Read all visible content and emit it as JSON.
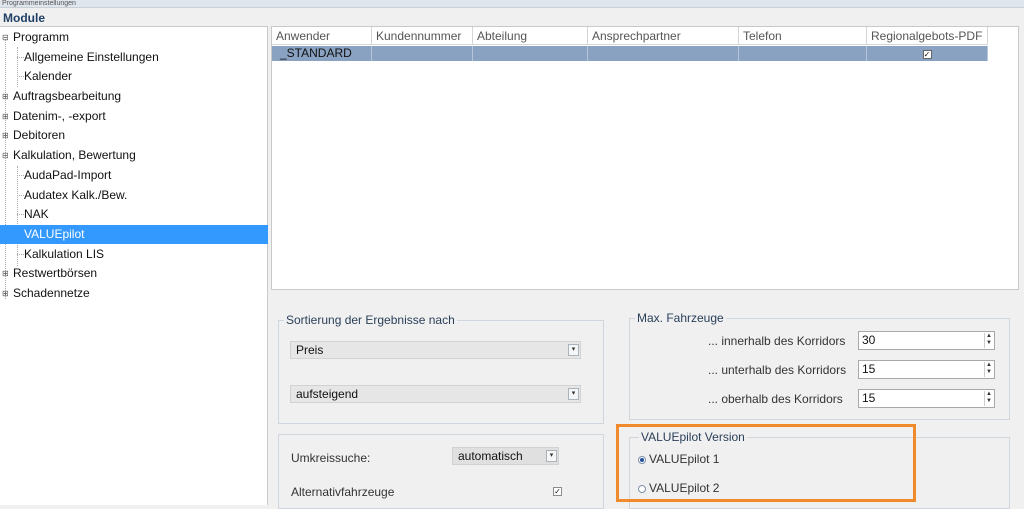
{
  "window": {
    "title": "Programmeinstellungen"
  },
  "modules": {
    "header": "Module"
  },
  "tree": [
    {
      "label": "Programm",
      "level": 0,
      "expander": "minus"
    },
    {
      "label": "Allgemeine Einstellungen",
      "level": 1
    },
    {
      "label": "Kalender",
      "level": 1
    },
    {
      "label": "Auftragsbearbeitung",
      "level": 0,
      "expander": "plus"
    },
    {
      "label": "Datenim-, -export",
      "level": 0,
      "expander": "plus"
    },
    {
      "label": "Debitoren",
      "level": 0,
      "expander": "plus"
    },
    {
      "label": "Kalkulation, Bewertung",
      "level": 0,
      "expander": "minus"
    },
    {
      "label": "AudaPad-Import",
      "level": 1
    },
    {
      "label": "Audatex Kalk./Bew.",
      "level": 1
    },
    {
      "label": "NAK",
      "level": 1
    },
    {
      "label": "VALUEpilot",
      "level": 1,
      "selected": true
    },
    {
      "label": "Kalkulation LIS",
      "level": 1
    },
    {
      "label": "Restwertbörsen",
      "level": 0,
      "expander": "plus"
    },
    {
      "label": "Schadennetze",
      "level": 0,
      "expander": "plus"
    }
  ],
  "grid": {
    "columns": [
      "Anwender",
      "Kundennummer",
      "Abteilung",
      "Ansprechpartner",
      "Telefon",
      "Regionalgebots-PDF"
    ],
    "rows": [
      {
        "anwender": "_STANDARD",
        "kundennummer": "",
        "abteilung": "",
        "ansprechpartner": "",
        "telefon": "",
        "regionalgebots_pdf": true
      }
    ]
  },
  "sort": {
    "title": "Sortierung der Ergebnisse nach",
    "field_value": "Preis",
    "order_value": "aufsteigend"
  },
  "max_vehicles": {
    "title": "Max. Fahrzeuge",
    "inside_label": "... innerhalb des Korridors",
    "inside_value": "30",
    "below_label": "... unterhalb des Korridors",
    "below_value": "15",
    "above_label": "... oberhalb des Korridors",
    "above_value": "15"
  },
  "radius": {
    "label": "Umkreissuche:",
    "value": "automatisch",
    "alt_label": "Alternativfahrzeuge",
    "alt_checked": true
  },
  "version": {
    "title": "VALUEpilot Version",
    "option1": "VALUEpilot 1",
    "option2": "VALUEpilot 2",
    "selected": 1
  },
  "colors": {
    "selection": "#3399ff",
    "highlight_border": "#f08a2c",
    "grid_row": "#8aa2c2"
  }
}
